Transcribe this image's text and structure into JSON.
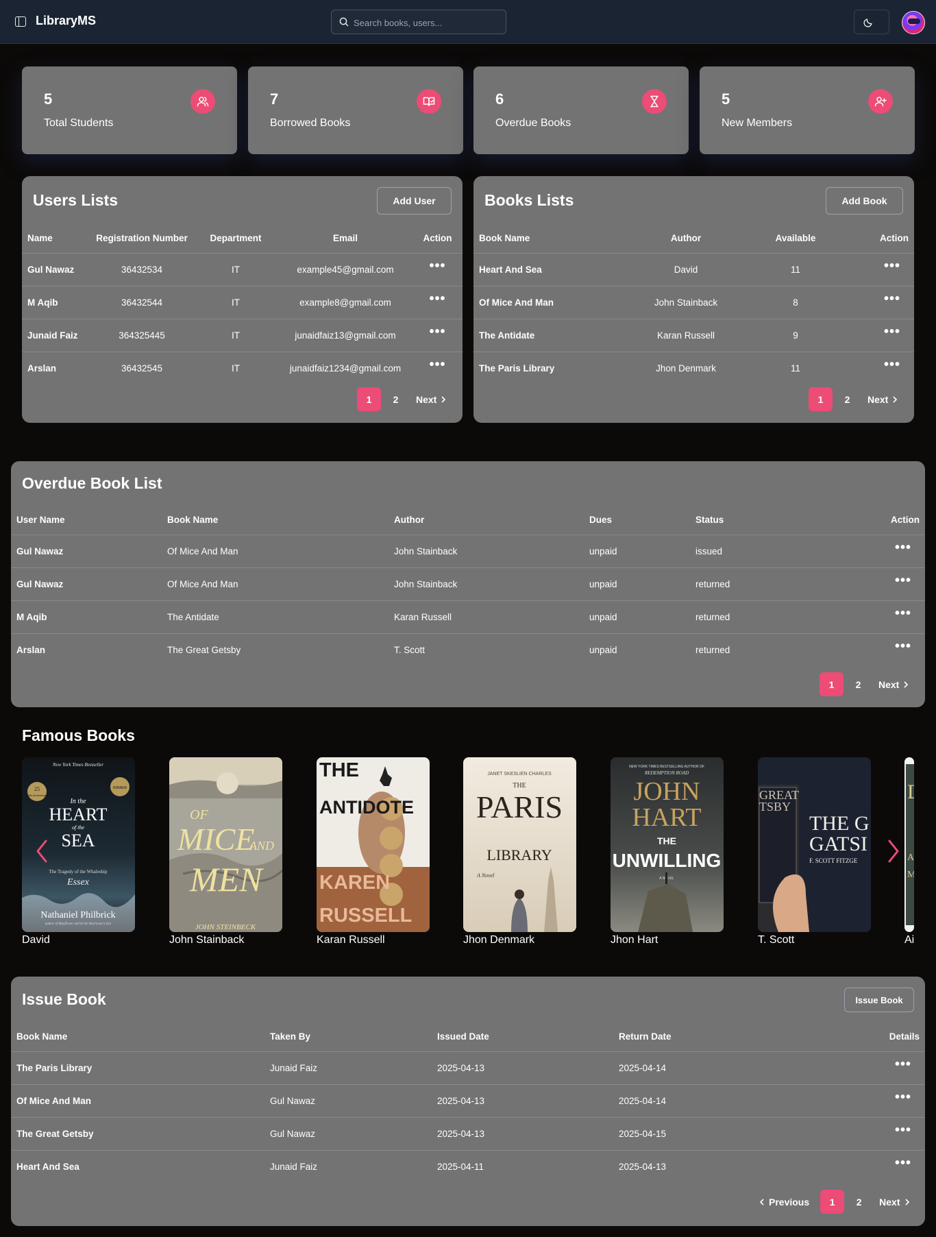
{
  "header": {
    "brand": "LibraryMS",
    "search_placeholder": "Search books, users..."
  },
  "stats": [
    {
      "value": "5",
      "label": "Total Students",
      "icon": "users-icon"
    },
    {
      "value": "7",
      "label": "Borrowed Books",
      "icon": "book-open-icon"
    },
    {
      "value": "6",
      "label": "Overdue Books",
      "icon": "hourglass-icon"
    },
    {
      "value": "5",
      "label": "New Members",
      "icon": "user-plus-icon"
    }
  ],
  "accent_color": "#ec4c76",
  "users": {
    "title": "Users Lists",
    "add_label": "Add User",
    "columns": [
      "Name",
      "Registration Number",
      "Department",
      "Email",
      "Action"
    ],
    "rows": [
      {
        "name": "Gul Nawaz",
        "reg": "36432534",
        "dept": "IT",
        "email": "example45@gmail.com"
      },
      {
        "name": "M Aqib",
        "reg": "36432544",
        "dept": "IT",
        "email": "example8@gmail.com"
      },
      {
        "name": "Junaid Faiz",
        "reg": "364325445",
        "dept": "IT",
        "email": "junaidfaiz13@gmail.com"
      },
      {
        "name": "Arslan",
        "reg": "36432545",
        "dept": "IT",
        "email": "junaidfaiz1234@gmail.com"
      }
    ],
    "pages": [
      "1",
      "2"
    ],
    "next": "Next"
  },
  "books": {
    "title": "Books Lists",
    "add_label": "Add Book",
    "columns": [
      "Book Name",
      "Author",
      "Available",
      "Action"
    ],
    "rows": [
      {
        "name": "Heart And Sea",
        "author": "David",
        "available": "11"
      },
      {
        "name": "Of Mice And Man",
        "author": "John Stainback",
        "available": "8"
      },
      {
        "name": "The Antidate",
        "author": "Karan Russell",
        "available": "9"
      },
      {
        "name": "The Paris Library",
        "author": "Jhon Denmark",
        "available": "11"
      }
    ],
    "pages": [
      "1",
      "2"
    ],
    "next": "Next"
  },
  "overdue": {
    "title": "Overdue Book List",
    "columns": [
      "User Name",
      "Book Name",
      "Author",
      "Dues",
      "Status",
      "Action"
    ],
    "rows": [
      {
        "user": "Gul Nawaz",
        "book": "Of Mice And Man",
        "author": "John Stainback",
        "dues": "unpaid",
        "status": "issued"
      },
      {
        "user": "Gul Nawaz",
        "book": "Of Mice And Man",
        "author": "John Stainback",
        "dues": "unpaid",
        "status": "returned"
      },
      {
        "user": "M Aqib",
        "book": "The Antidate",
        "author": "Karan Russell",
        "dues": "unpaid",
        "status": "returned"
      },
      {
        "user": "Arslan",
        "book": "The Great Getsby",
        "author": "T. Scott",
        "dues": "unpaid",
        "status": "returned"
      }
    ],
    "pages": [
      "1",
      "2"
    ],
    "next": "Next"
  },
  "famous": {
    "title": "Famous Books",
    "books": [
      {
        "author": "David",
        "cover_lines": [
          "New York Times Bestseller",
          "25th Anniversary",
          "WINNER",
          "In the",
          "HEART",
          "of the",
          "SEA",
          "The Tragedy of the Whaleship",
          "Essex",
          "Nathaniel Philbrick",
          "author of Mayflower and In the Hurricane's Eye"
        ]
      },
      {
        "author": "John Stainback",
        "cover_lines": [
          "OF",
          "MICE",
          "AND",
          "MEN",
          "JOHN STEINBECK"
        ]
      },
      {
        "author": "Karan Russell",
        "cover_lines": [
          "THE",
          "ANTIDOTE",
          "KAREN",
          "RUSSELL"
        ]
      },
      {
        "author": "Jhon Denmark",
        "cover_lines": [
          "JANET SKESLIEN CHARLES",
          "THE",
          "PARIS",
          "LIBRARY",
          "A Novel"
        ]
      },
      {
        "author": "Jhon Hart",
        "cover_lines": [
          "NEW YORK TIMES BESTSELLING AUTHOR OF",
          "REDEMPTION ROAD",
          "JOHN",
          "HART",
          "THE",
          "UNWILLING",
          "A NOVEL"
        ]
      },
      {
        "author": "T. Scott",
        "cover_lines": [
          "GREAT",
          "TSBY",
          "THE G",
          "GATSI",
          "F. SCOTT FITZGE"
        ]
      },
      {
        "author": "Ai",
        "cover_lines": [
          "D",
          "A",
          "M"
        ]
      }
    ]
  },
  "issue": {
    "title": "Issue Book",
    "button_label": "Issue Book",
    "columns": [
      "Book Name",
      "Taken By",
      "Issued Date",
      "Return Date",
      "Details"
    ],
    "rows": [
      {
        "book": "The Paris Library",
        "by": "Junaid Faiz",
        "issued": "2025-04-13",
        "returned": "2025-04-14"
      },
      {
        "book": "Of Mice And Man",
        "by": "Gul Nawaz",
        "issued": "2025-04-13",
        "returned": "2025-04-14"
      },
      {
        "book": "The Great Getsby",
        "by": "Gul Nawaz",
        "issued": "2025-04-13",
        "returned": "2025-04-15"
      },
      {
        "book": "Heart And Sea",
        "by": "Junaid Faiz",
        "issued": "2025-04-11",
        "returned": "2025-04-13"
      }
    ],
    "previous": "Previous",
    "pages": [
      "1",
      "2"
    ],
    "next": "Next"
  }
}
